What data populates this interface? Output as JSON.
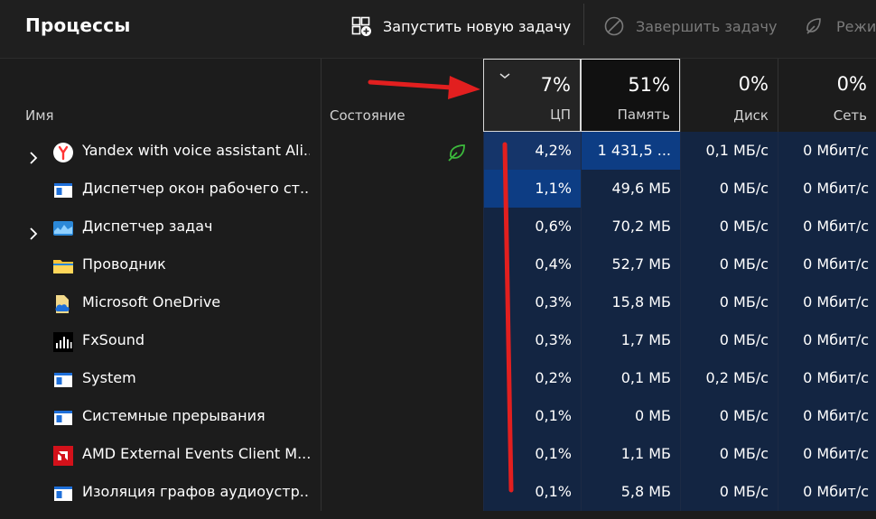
{
  "toolbar": {
    "title": "Процессы",
    "run_new_task": "Запустить новую задачу",
    "end_task": "Завершить задачу",
    "efficiency": "Режи"
  },
  "columns": {
    "name": "Имя",
    "status": "Состояние",
    "cpu": {
      "pct": "7%",
      "label": "ЦП"
    },
    "mem": {
      "pct": "51%",
      "label": "Память"
    },
    "disk": {
      "pct": "0%",
      "label": "Диск"
    },
    "net": {
      "pct": "0%",
      "label": "Сеть"
    }
  },
  "processes": [
    {
      "name": "Yandex with voice assistant Ali...",
      "icon": "yandex-browser-icon",
      "cpu": "4,2%",
      "mem": "1 431,5 ...",
      "disk": "0,1 МБ/с",
      "net": "0 Мбит/с"
    },
    {
      "name": "Диспетчер окон рабочего ст...",
      "icon": "app-window-icon",
      "cpu": "1,1%",
      "mem": "49,6 МБ",
      "disk": "0 МБ/с",
      "net": "0 Мбит/с"
    },
    {
      "name": "Диспетчер задач",
      "icon": "task-manager-icon",
      "cpu": "0,6%",
      "mem": "70,2 МБ",
      "disk": "0 МБ/с",
      "net": "0 Мбит/с"
    },
    {
      "name": "Проводник",
      "icon": "folder-icon",
      "cpu": "0,4%",
      "mem": "52,7 МБ",
      "disk": "0 МБ/с",
      "net": "0 Мбит/с"
    },
    {
      "name": "Microsoft OneDrive",
      "icon": "onedrive-icon",
      "cpu": "0,3%",
      "mem": "15,8 МБ",
      "disk": "0 МБ/с",
      "net": "0 Мбит/с"
    },
    {
      "name": "FxSound",
      "icon": "fxsound-icon",
      "cpu": "0,3%",
      "mem": "1,7 МБ",
      "disk": "0 МБ/с",
      "net": "0 Мбит/с"
    },
    {
      "name": "System",
      "icon": "app-window-icon",
      "cpu": "0,2%",
      "mem": "0,1 МБ",
      "disk": "0,2 МБ/с",
      "net": "0 Мбит/с"
    },
    {
      "name": "Системные прерывания",
      "icon": "app-window-icon",
      "cpu": "0,1%",
      "mem": "0 МБ",
      "disk": "0 МБ/с",
      "net": "0 Мбит/с"
    },
    {
      "name": "AMD External Events Client M...",
      "icon": "amd-icon",
      "cpu": "0,1%",
      "mem": "1,1 МБ",
      "disk": "0 МБ/с",
      "net": "0 Мбит/с"
    },
    {
      "name": "Изоляция графов аудиоустр...",
      "icon": "app-window-icon",
      "cpu": "0,1%",
      "mem": "5,8 МБ",
      "disk": "0 МБ/с",
      "net": "0 Мбит/с"
    }
  ],
  "colors": {
    "accent_arrow": "#e21f1f",
    "heat_low": "#132542",
    "heat_mid": "#15356a",
    "heat_high": "#0d3d84",
    "eco_leaf": "#3cb93c"
  }
}
